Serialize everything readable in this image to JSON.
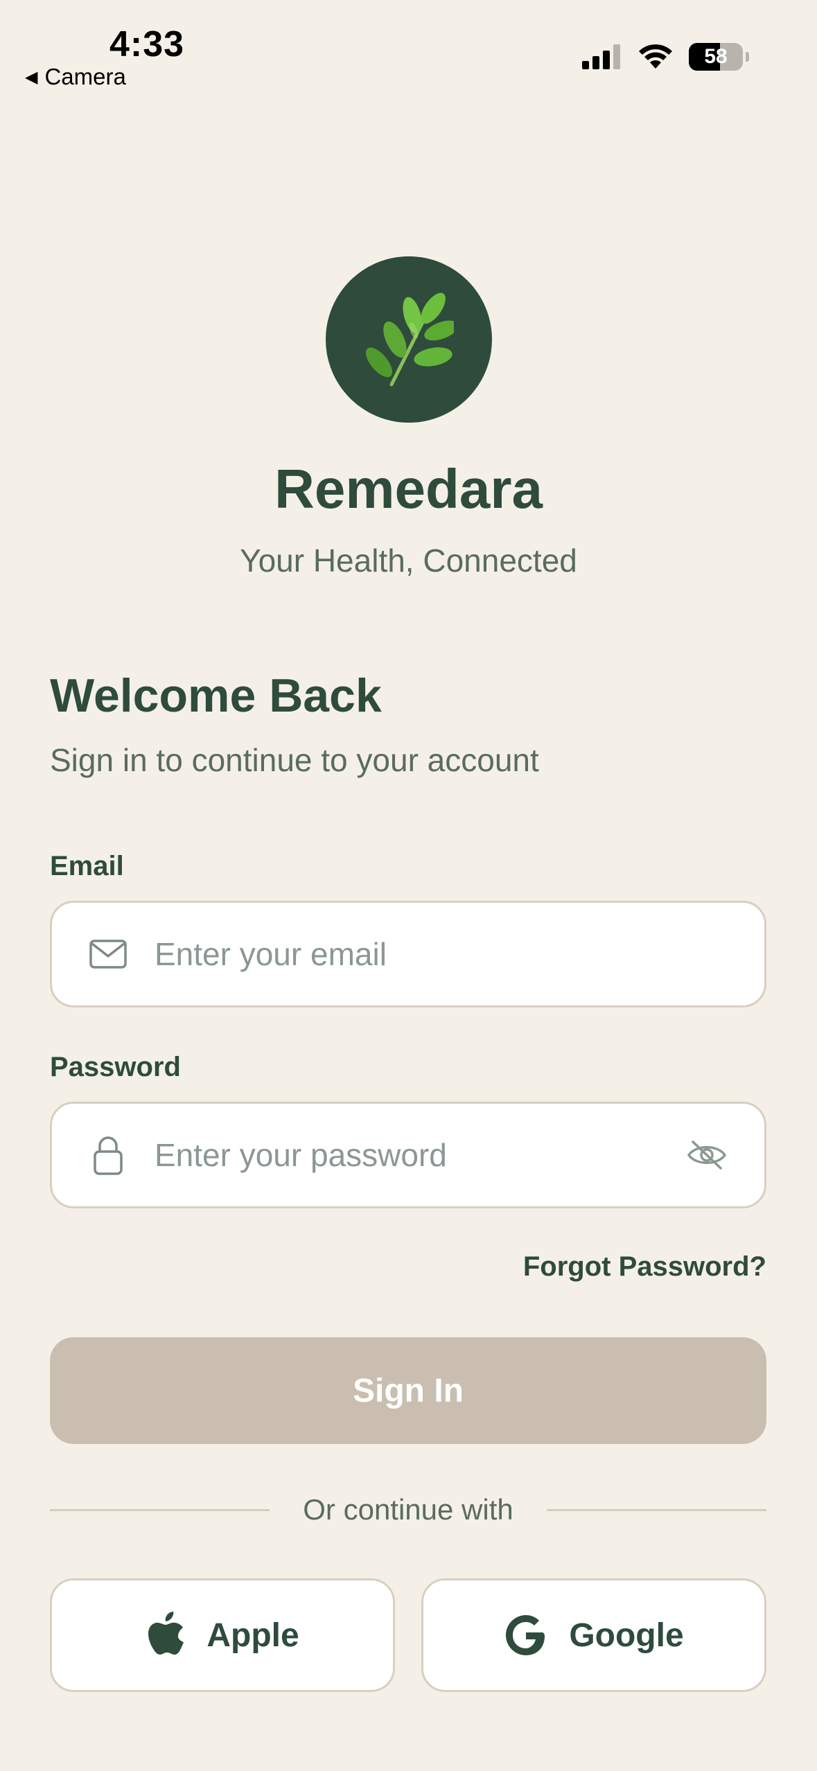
{
  "status_bar": {
    "time": "4:33",
    "back_label": "Camera",
    "battery_percent": "58",
    "battery_level": 0.58
  },
  "brand": {
    "logo_icon": "herb-leaf-icon",
    "name": "Remedara",
    "tagline": "Your Health, Connected"
  },
  "welcome": {
    "title": "Welcome Back",
    "subtitle": "Sign in to continue to your account"
  },
  "email": {
    "label": "Email",
    "placeholder": "Enter your email",
    "value": ""
  },
  "password": {
    "label": "Password",
    "placeholder": "Enter your password",
    "value": ""
  },
  "forgot_label": "Forgot Password?",
  "signin_label": "Sign In",
  "divider_text": "Or continue with",
  "social": {
    "apple_label": "Apple",
    "google_label": "Google"
  },
  "colors": {
    "background": "#f4f0e8",
    "primary_green": "#2e4b3c",
    "button_disabled": "#c9beb0",
    "border": "#d9cfc0"
  }
}
